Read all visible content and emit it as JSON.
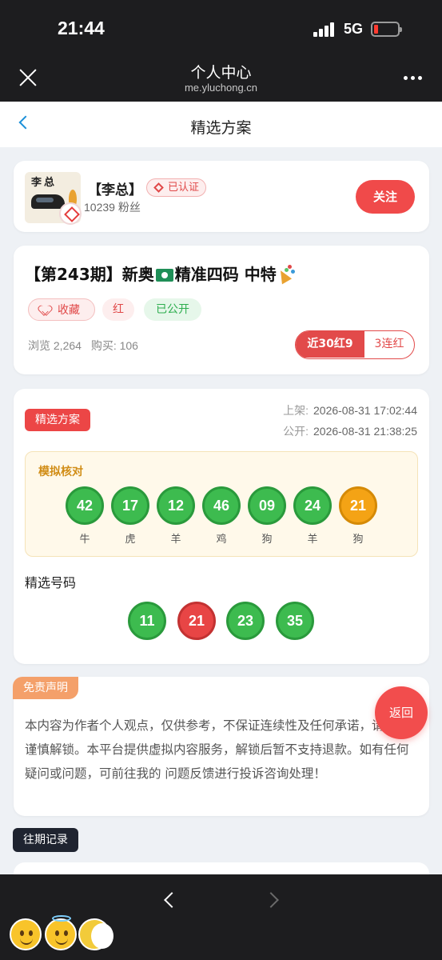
{
  "status_bar": {
    "time": "21:44",
    "network": "5G"
  },
  "webview": {
    "title": "个人中心",
    "domain": "me.yluchong.cn"
  },
  "nav": {
    "title": "精选方案"
  },
  "author": {
    "avatar_text": "李总",
    "name": "【李总】",
    "verified_label": "已认证",
    "fans": "10239 粉丝",
    "follow_label": "关注"
  },
  "post": {
    "title_prefix": "【第243期】新奥",
    "title_suffix": "精准四码 中特",
    "fav_label": "收藏",
    "red_label": "红",
    "public_label": "已公开",
    "views_label": "浏览",
    "views": "2,264",
    "buy_label": "购买:",
    "buys": "106",
    "record_label": "近30红9",
    "streak_label": "3连红"
  },
  "plan": {
    "tag": "精选方案",
    "listed_label": "上架:",
    "listed_time": "2026-08-31 17:02:44",
    "public_label": "公开:",
    "public_time": "2026-08-31 21:38:25",
    "sim_title": "模拟核对",
    "sim_balls": [
      {
        "num": "42",
        "zodiac": "牛",
        "color": "green"
      },
      {
        "num": "17",
        "zodiac": "虎",
        "color": "green"
      },
      {
        "num": "12",
        "zodiac": "羊",
        "color": "green"
      },
      {
        "num": "46",
        "zodiac": "鸡",
        "color": "green"
      },
      {
        "num": "09",
        "zodiac": "狗",
        "color": "green"
      },
      {
        "num": "24",
        "zodiac": "羊",
        "color": "green"
      },
      {
        "num": "21",
        "zodiac": "狗",
        "color": "orange"
      }
    ],
    "picked_title": "精选号码",
    "picked_balls": [
      {
        "num": "11",
        "color": "green"
      },
      {
        "num": "21",
        "color": "red"
      },
      {
        "num": "23",
        "color": "green"
      },
      {
        "num": "35",
        "color": "green"
      }
    ]
  },
  "disclaimer": {
    "tag": "免责声明",
    "text": "本内容为作者个人观点，仅供参考，不保证连续性及任何承诺，请理性谨慎解锁。本平台提供虚拟内容服务，解锁后暂不支持退款。如有任何疑问或问题，可前往我的 问题反馈进行投诉咨询处理！"
  },
  "float_back_label": "返回",
  "history_tag": "往期记录",
  "colors": {
    "accent_red": "#ec4646",
    "ball_green": "#3dbb4f",
    "ball_orange": "#f4a315",
    "dark_bar": "#1d1d1f"
  }
}
